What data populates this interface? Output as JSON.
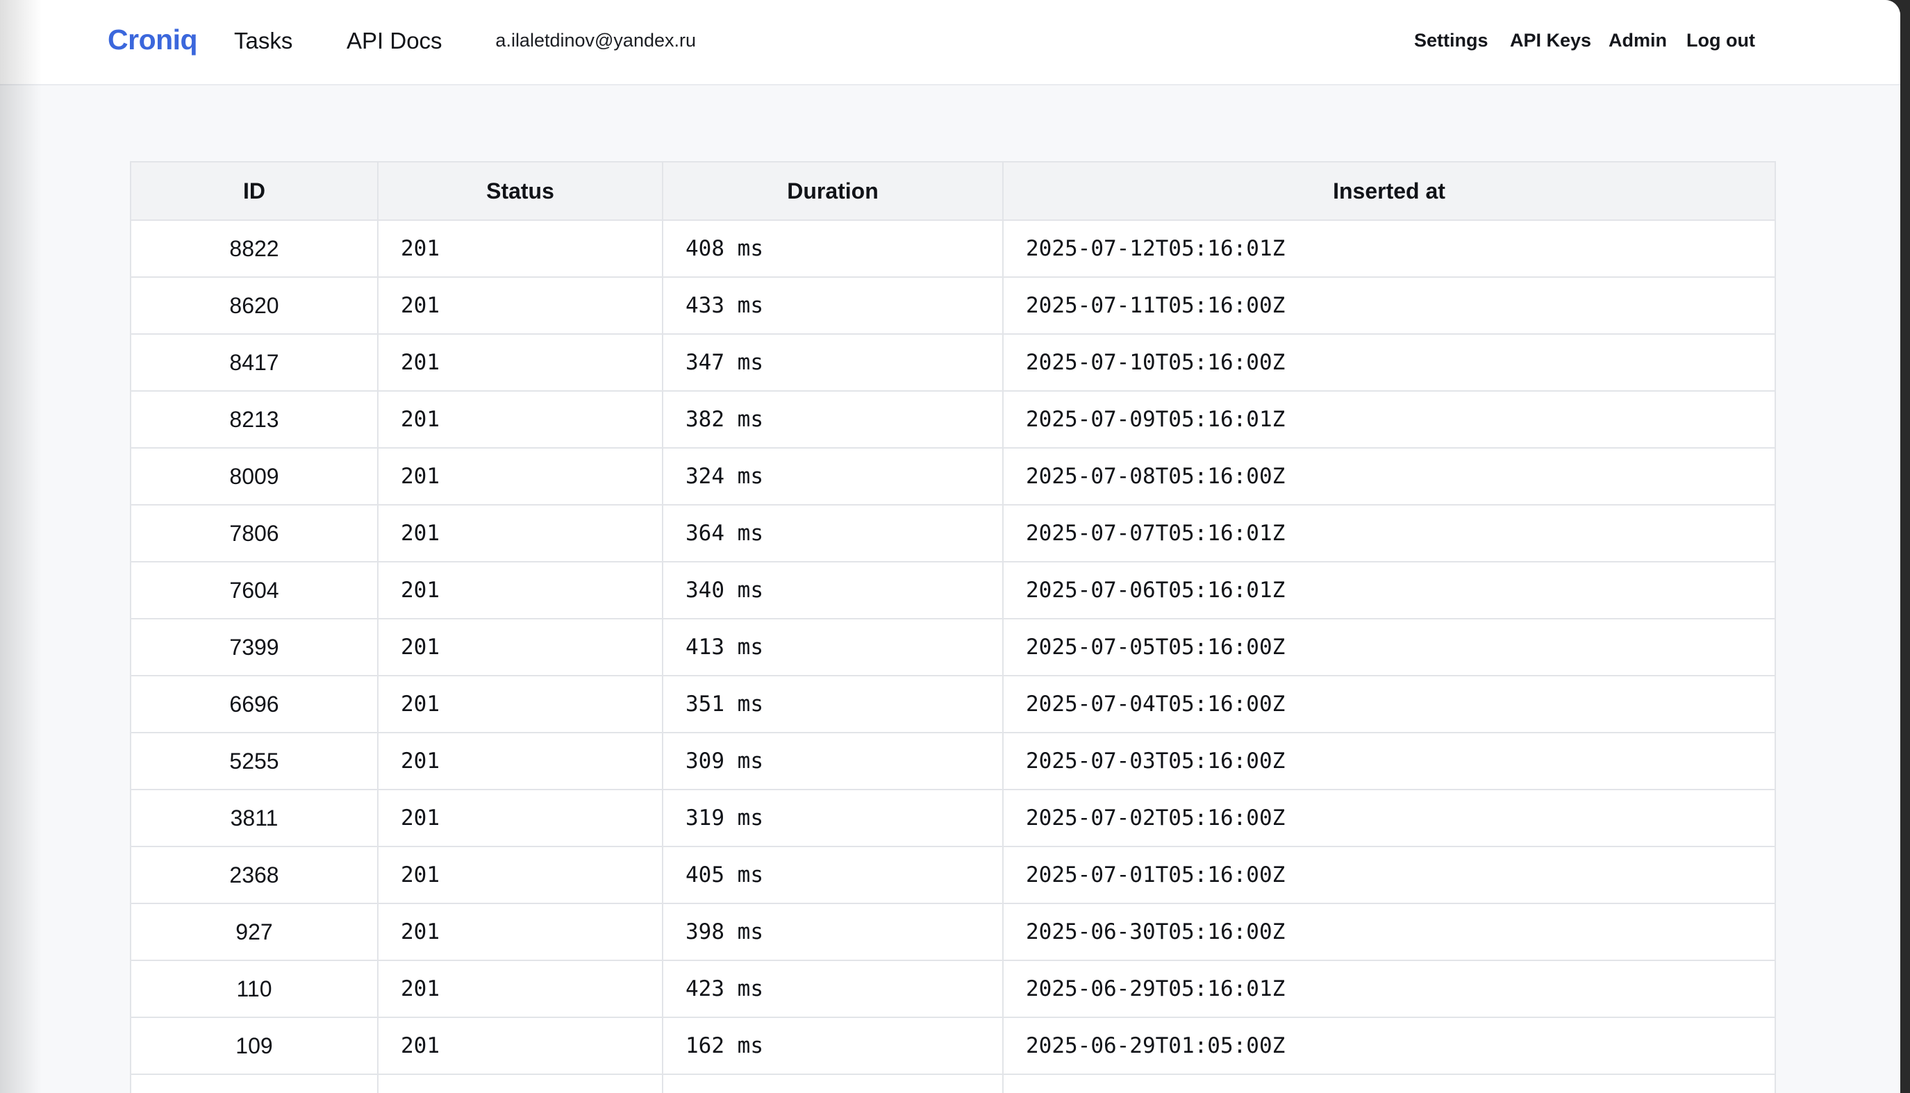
{
  "header": {
    "brand": "Croniq",
    "nav": [
      "Tasks",
      "API Docs"
    ],
    "user_email": "a.ilaletdinov@yandex.ru",
    "right_links": [
      "Settings",
      "API Keys",
      "Admin",
      "Log out"
    ]
  },
  "table": {
    "columns": [
      "ID",
      "Status",
      "Duration",
      "Inserted at"
    ],
    "rows": [
      [
        "8822",
        "201",
        "408 ms",
        "2025-07-12T05:16:01Z"
      ],
      [
        "8620",
        "201",
        "433 ms",
        "2025-07-11T05:16:00Z"
      ],
      [
        "8417",
        "201",
        "347 ms",
        "2025-07-10T05:16:00Z"
      ],
      [
        "8213",
        "201",
        "382 ms",
        "2025-07-09T05:16:01Z"
      ],
      [
        "8009",
        "201",
        "324 ms",
        "2025-07-08T05:16:00Z"
      ],
      [
        "7806",
        "201",
        "364 ms",
        "2025-07-07T05:16:01Z"
      ],
      [
        "7604",
        "201",
        "340 ms",
        "2025-07-06T05:16:01Z"
      ],
      [
        "7399",
        "201",
        "413 ms",
        "2025-07-05T05:16:00Z"
      ],
      [
        "6696",
        "201",
        "351 ms",
        "2025-07-04T05:16:00Z"
      ],
      [
        "5255",
        "201",
        "309 ms",
        "2025-07-03T05:16:00Z"
      ],
      [
        "3811",
        "201",
        "319 ms",
        "2025-07-02T05:16:00Z"
      ],
      [
        "2368",
        "201",
        "405 ms",
        "2025-07-01T05:16:00Z"
      ],
      [
        "927",
        "201",
        "398 ms",
        "2025-06-30T05:16:00Z"
      ],
      [
        "110",
        "201",
        "423 ms",
        "2025-06-29T05:16:01Z"
      ],
      [
        "109",
        "201",
        "162 ms",
        "2025-06-29T01:05:00Z"
      ],
      [
        "",
        "",
        "",
        ""
      ]
    ]
  }
}
